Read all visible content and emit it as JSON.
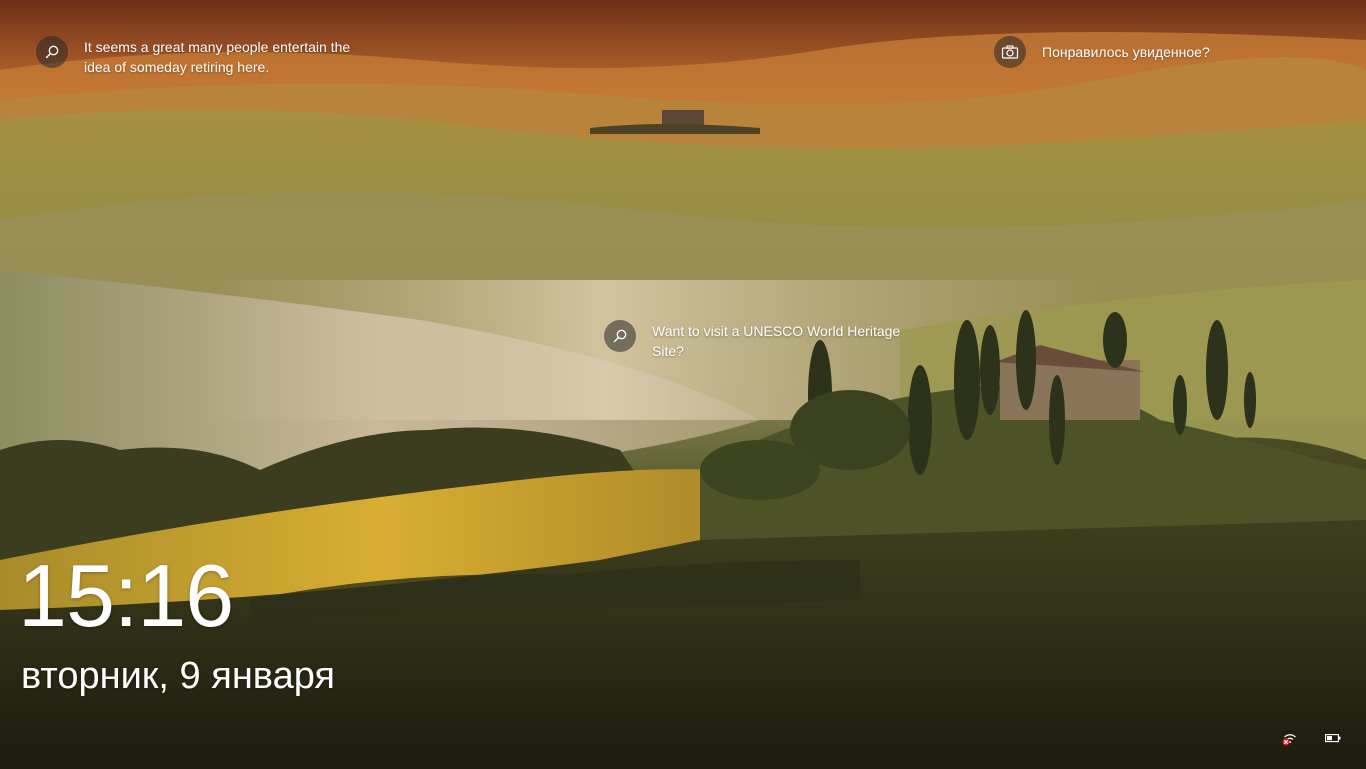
{
  "lockscreen": {
    "spotlight_hints": {
      "top": {
        "text": "It seems a great many people entertain the idea of someday retiring here.",
        "icon": "search-icon"
      },
      "middle": {
        "text": "Want to visit a UNESCO World Heritage Site?",
        "icon": "search-icon"
      },
      "like": {
        "text": "Понравилось увиденное?",
        "icon": "camera-icon"
      }
    },
    "time": "15:16",
    "date": "вторник, 9 января",
    "tray": {
      "network_icon": "network-disconnected-icon",
      "battery_icon": "battery-icon"
    }
  }
}
